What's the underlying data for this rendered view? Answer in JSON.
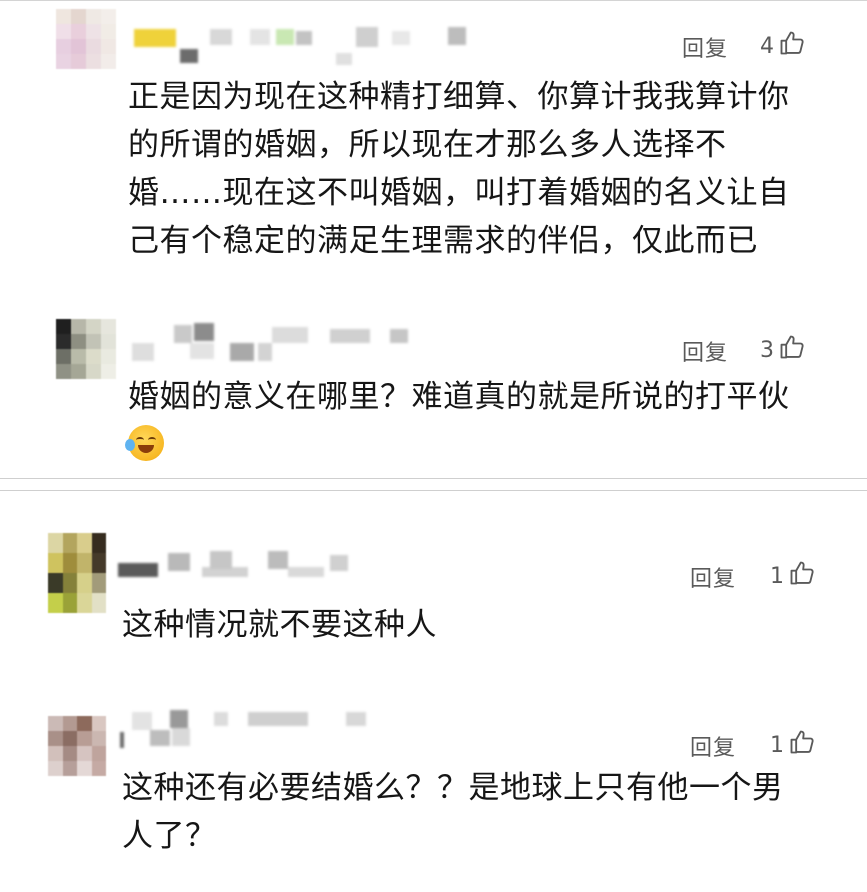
{
  "comments": [
    {
      "reply_label": "回复",
      "like_count": "4",
      "lines": [
        "正是因为现在这种精打细算、你算计我我算计你",
        "的所谓的婚姻，所以现在才那么多人选择不",
        "婚……现在这不叫婚姻，叫打着婚姻的名义让自",
        "己有个稳定的满足生理需求的伴侣，仅此而已"
      ]
    },
    {
      "reply_label": "回复",
      "like_count": "3",
      "lines": [
        "婚姻的意义在哪里？难道真的就是所说的打平伙"
      ],
      "emoji": "laughing-crying-emoji"
    },
    {
      "reply_label": "回复",
      "like_count": "1",
      "lines": [
        "这种情况就不要这种人"
      ]
    },
    {
      "reply_label": "回复",
      "like_count": "1",
      "lines": [
        "这种还有必要结婚么？？是地球上只有他一个男",
        "人了？"
      ]
    }
  ],
  "icons": {
    "like": "thumbs-up-outline-icon"
  },
  "colors": {
    "text": "#161616",
    "secondary": "#5a5a5a",
    "divider": "#cfcfcf"
  }
}
